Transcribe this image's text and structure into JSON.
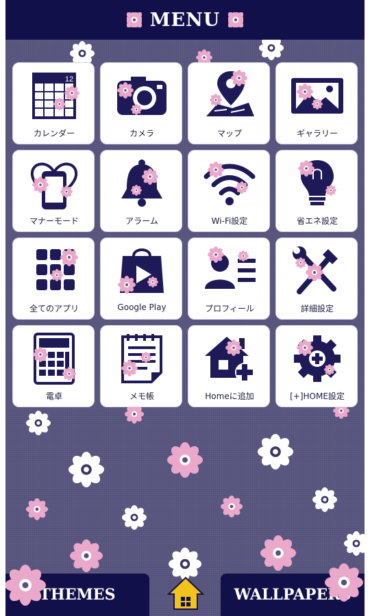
{
  "header": {
    "title": "MENU"
  },
  "menu": [
    {
      "label": "カレンダー",
      "icon": "calendar-icon",
      "name": "menu-item-calendar",
      "badge": "12"
    },
    {
      "label": "カメラ",
      "icon": "camera-icon",
      "name": "menu-item-camera"
    },
    {
      "label": "マップ",
      "icon": "map-pin-icon",
      "name": "menu-item-map"
    },
    {
      "label": "ギャラリー",
      "icon": "gallery-icon",
      "name": "menu-item-gallery"
    },
    {
      "label": "マナーモード",
      "icon": "manner-mode-icon",
      "name": "menu-item-manner-mode"
    },
    {
      "label": "アラーム",
      "icon": "alarm-bell-icon",
      "name": "menu-item-alarm"
    },
    {
      "label": "Wi-Fi設定",
      "icon": "wifi-icon",
      "name": "menu-item-wifi"
    },
    {
      "label": "省エネ設定",
      "icon": "bulb-icon",
      "name": "menu-item-eco"
    },
    {
      "label": "全てのアプリ",
      "icon": "all-apps-icon",
      "name": "menu-item-all-apps"
    },
    {
      "label": "Google Play",
      "icon": "google-play-icon",
      "name": "menu-item-google-play"
    },
    {
      "label": "プロフィール",
      "icon": "profile-icon",
      "name": "menu-item-profile"
    },
    {
      "label": "詳細設定",
      "icon": "tools-icon",
      "name": "menu-item-settings"
    },
    {
      "label": "電卓",
      "icon": "calculator-icon",
      "name": "menu-item-calculator"
    },
    {
      "label": "メモ帳",
      "icon": "memo-pad-icon",
      "name": "menu-item-memo"
    },
    {
      "label": "Homeに追加",
      "icon": "add-home-icon",
      "name": "menu-item-add-home"
    },
    {
      "label": "[+]HOME設定",
      "icon": "home-settings-gear-icon",
      "name": "menu-item-home-settings"
    }
  ],
  "bottom": {
    "themes": "THEMES",
    "wallpapers": "WALLPAPERS"
  },
  "colors": {
    "header": "#12104a",
    "background": "#58557f",
    "icon": "#1e1a58",
    "flower_pink": "#e8a6c8",
    "flower_white": "#ffffff"
  }
}
